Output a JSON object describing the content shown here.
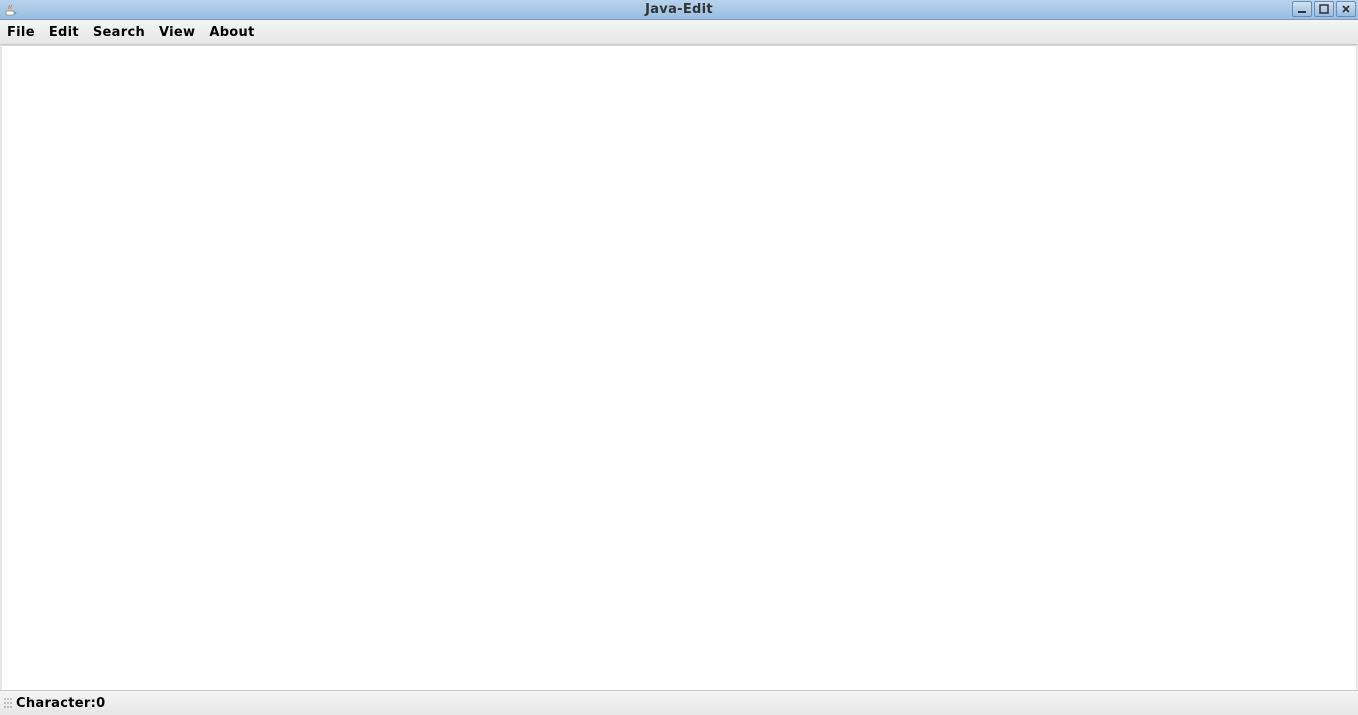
{
  "window": {
    "title": "Java-Edit"
  },
  "menubar": {
    "items": [
      {
        "label": "File"
      },
      {
        "label": "Edit"
      },
      {
        "label": "Search"
      },
      {
        "label": "View"
      },
      {
        "label": "About"
      }
    ]
  },
  "editor": {
    "content": ""
  },
  "statusbar": {
    "character_label": "Character:",
    "character_count": "0"
  }
}
